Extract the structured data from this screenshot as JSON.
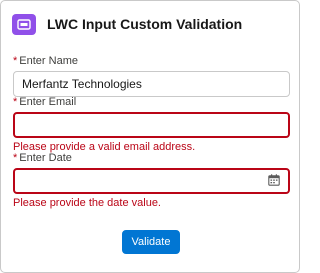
{
  "header": {
    "title": "LWC Input Custom Validation",
    "icon": "form-icon",
    "icon_color": "#9050e9"
  },
  "fields": [
    {
      "label": "Enter Name",
      "required_mark": "*",
      "value": "Merfantz Technologies",
      "error": ""
    },
    {
      "label": "Enter Email",
      "required_mark": "*",
      "value": "",
      "error": "Please provide a valid email address."
    },
    {
      "label": "Enter Date",
      "required_mark": "*",
      "value": "",
      "error": "Please provide the date value.",
      "icon": "calendar-icon"
    }
  ],
  "button": {
    "label": "Validate"
  },
  "colors": {
    "accent": "#0176d3",
    "error": "#ba0517"
  }
}
